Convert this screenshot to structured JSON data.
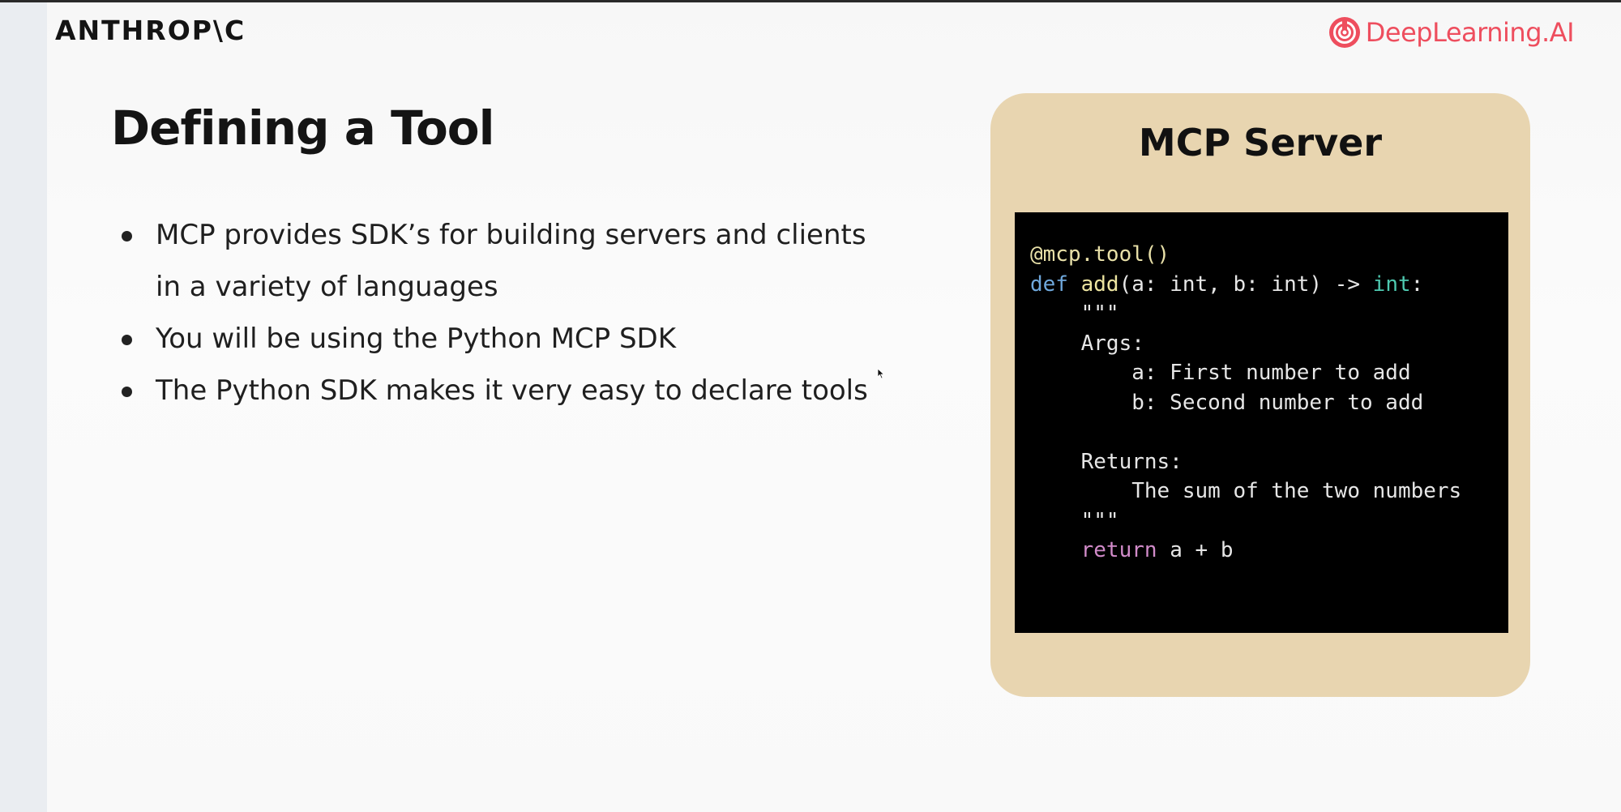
{
  "header": {
    "anthropic_logo_text": "ANTHROP\\C",
    "deeplearning_logo_text": "DeepLearning.AI"
  },
  "slide": {
    "title": "Defining a Tool",
    "bullets": [
      "MCP provides SDK’s for building servers and clients in a variety of languages",
      "You will be using the Python MCP SDK",
      "The Python SDK makes it very easy to declare tools"
    ]
  },
  "server_card": {
    "title": "MCP Server",
    "code": {
      "decorator": "@mcp.tool()",
      "def_keyword": "def",
      "function_name": "add",
      "signature_params": "(a: int, b: int) -> ",
      "return_type": "int",
      "signature_end": ":",
      "docstring_open": "    \"\"\"",
      "args_header": "    Args:",
      "arg_a": "        a: First number to add",
      "arg_b": "        b: Second number to add",
      "blank": "",
      "returns_header": "    Returns:",
      "returns_desc": "        The sum of the two numbers",
      "docstring_close": "    \"\"\"",
      "return_indent": "    ",
      "return_keyword": "return",
      "return_expr": " a + b"
    }
  },
  "colors": {
    "card_background": "#e8d5b0",
    "code_background": "#000000",
    "deeplearning_red": "#ee4e5e",
    "keyword_blue": "#6fa8dc",
    "type_teal": "#4ec9b0",
    "return_purple": "#d18bc9",
    "decorator_yellow": "#e8e0a8"
  },
  "icons": {
    "deeplearning_logo": "deeplearning-swirl-icon",
    "cursor": "mouse-pointer-icon",
    "bullet": "bullet-dot-icon"
  }
}
